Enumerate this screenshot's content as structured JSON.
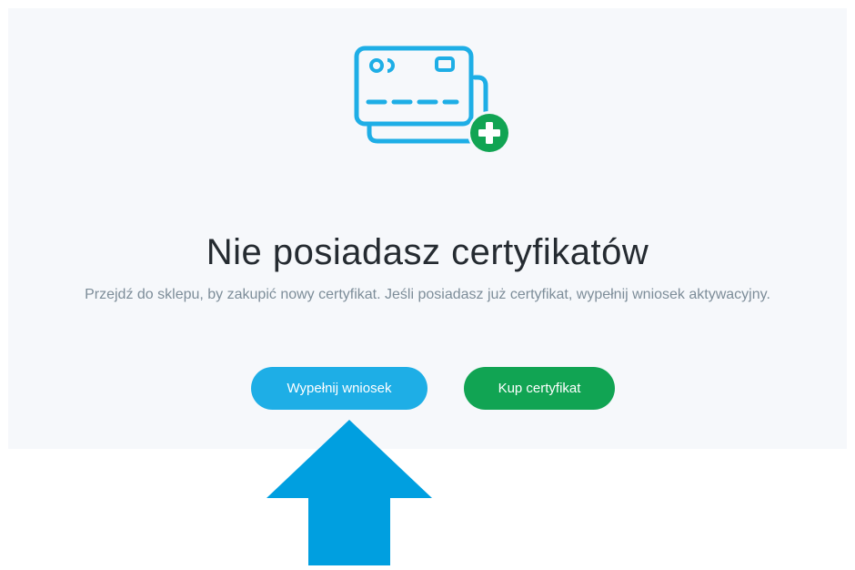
{
  "colors": {
    "panel_background": "#f6f8fb",
    "title_text": "#252b31",
    "subtitle_text": "#7d8d99",
    "fill_button": "#1eaee6",
    "buy_button": "#11a453",
    "illustration_stroke": "#1eaee6",
    "plus_badge": "#11a453",
    "annotation_arrow": "#009fe0"
  },
  "icons": {
    "illustration": "credit-card-add-icon",
    "annotation": "up-arrow-annotation"
  },
  "empty_state": {
    "title": "Nie posiadasz certyfikatów",
    "description": "Przejdź do sklepu, by zakupić nowy certyfikat. Jeśli posiadasz już certyfikat, wypełnij wniosek aktywacyjny."
  },
  "actions": {
    "fill_application_label": "Wypełnij wniosek",
    "buy_certificate_label": "Kup certyfikat"
  }
}
